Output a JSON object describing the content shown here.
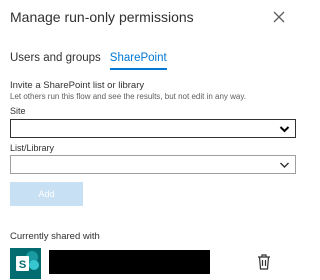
{
  "panel": {
    "title": "Manage run-only permissions",
    "close_icon": "close-icon"
  },
  "tabs": [
    {
      "label": "Users and groups",
      "selected": false
    },
    {
      "label": "SharePoint",
      "selected": true
    }
  ],
  "invite": {
    "heading": "Invite a SharePoint list or library",
    "description": "Let others run this flow and see the results, but not edit in any way."
  },
  "fields": {
    "site": {
      "label": "Site",
      "value": ""
    },
    "library": {
      "label": "List/Library",
      "value": ""
    }
  },
  "buttons": {
    "add_label": "Add"
  },
  "shared": {
    "heading": "Currently shared with",
    "entries": [
      {
        "icon": "sharepoint-icon",
        "name_redacted": true,
        "action_icon": "trash-icon"
      }
    ]
  },
  "colors": {
    "accent": "#0078d4",
    "disabled_button": "#c7e0f4",
    "sharepoint": "#036c70"
  }
}
